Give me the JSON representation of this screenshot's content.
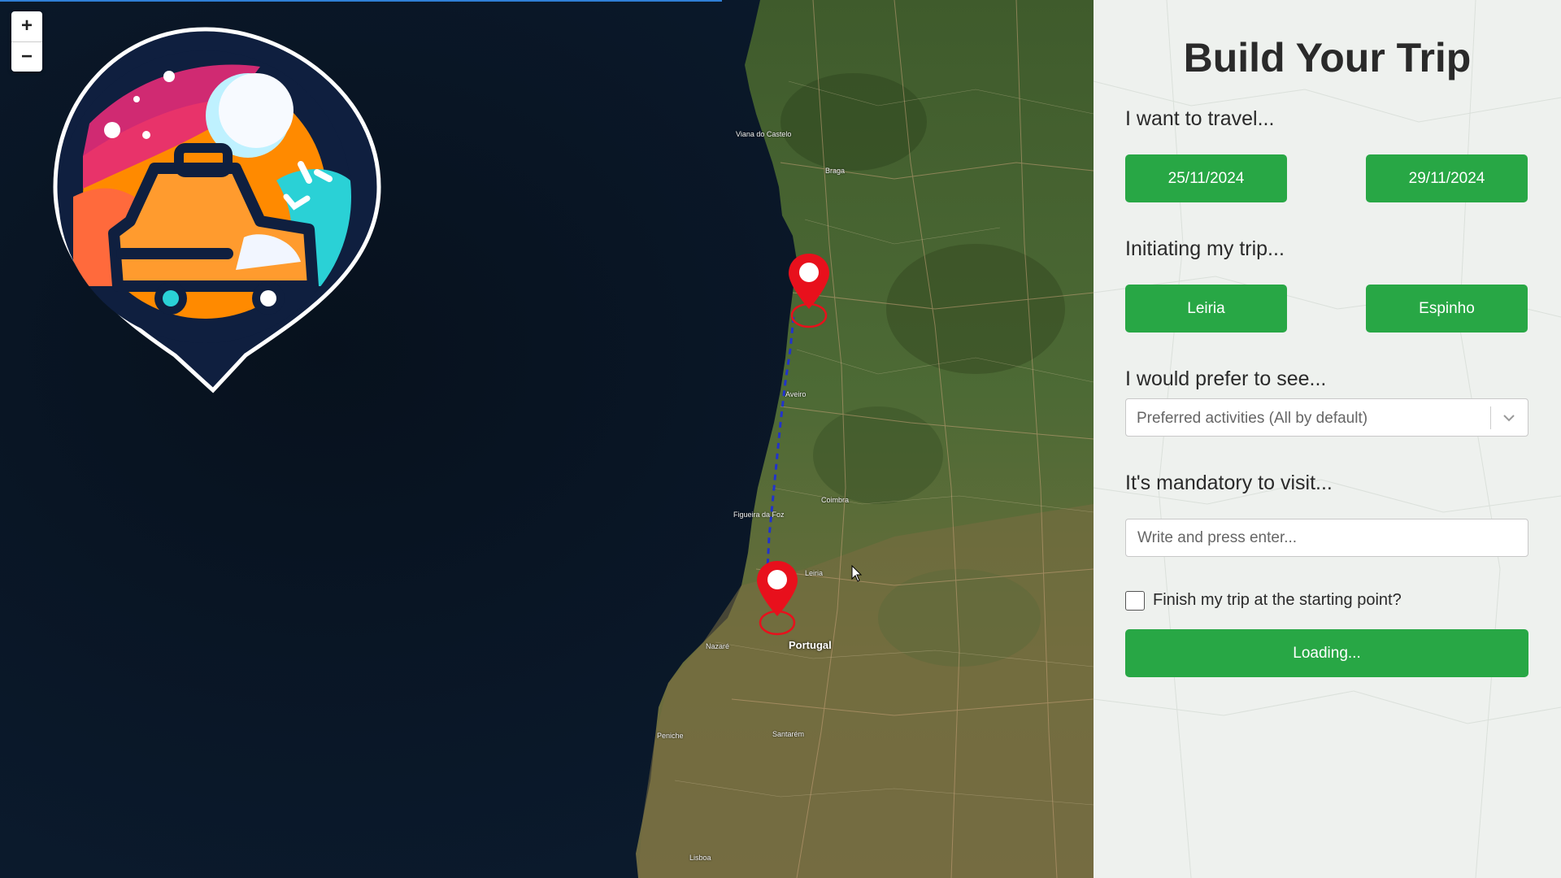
{
  "map": {
    "zoom_in": "+",
    "zoom_out": "−",
    "country_label": "Portugal",
    "city_labels": [
      "Viana do Castelo",
      "Braga",
      "Aveiro",
      "Coimbra",
      "Figueira da Foz",
      "Leiria",
      "Lisboa",
      "Nazaré",
      "Peniche",
      "Santarém"
    ],
    "route_color": "#2233cc",
    "marker_color": "#e8101c",
    "logo_name": "trip-planner-logo-icon"
  },
  "panel": {
    "title": "Build Your Trip",
    "travel_heading": "I want to travel...",
    "start_date": "25/11/2024",
    "end_date": "29/11/2024",
    "initiating_heading": "Initiating my trip...",
    "start_city": "Leiria",
    "end_city": "Espinho",
    "prefer_heading": "I would prefer to see...",
    "activities_placeholder": "Preferred activities (All by default)",
    "mandatory_heading": "It's mandatory to visit...",
    "visit_placeholder": "Write and press enter...",
    "finish_label": "Finish my trip at the starting point?",
    "finish_checked": false,
    "submit_label": "Loading...",
    "accent_color": "#28a745"
  }
}
